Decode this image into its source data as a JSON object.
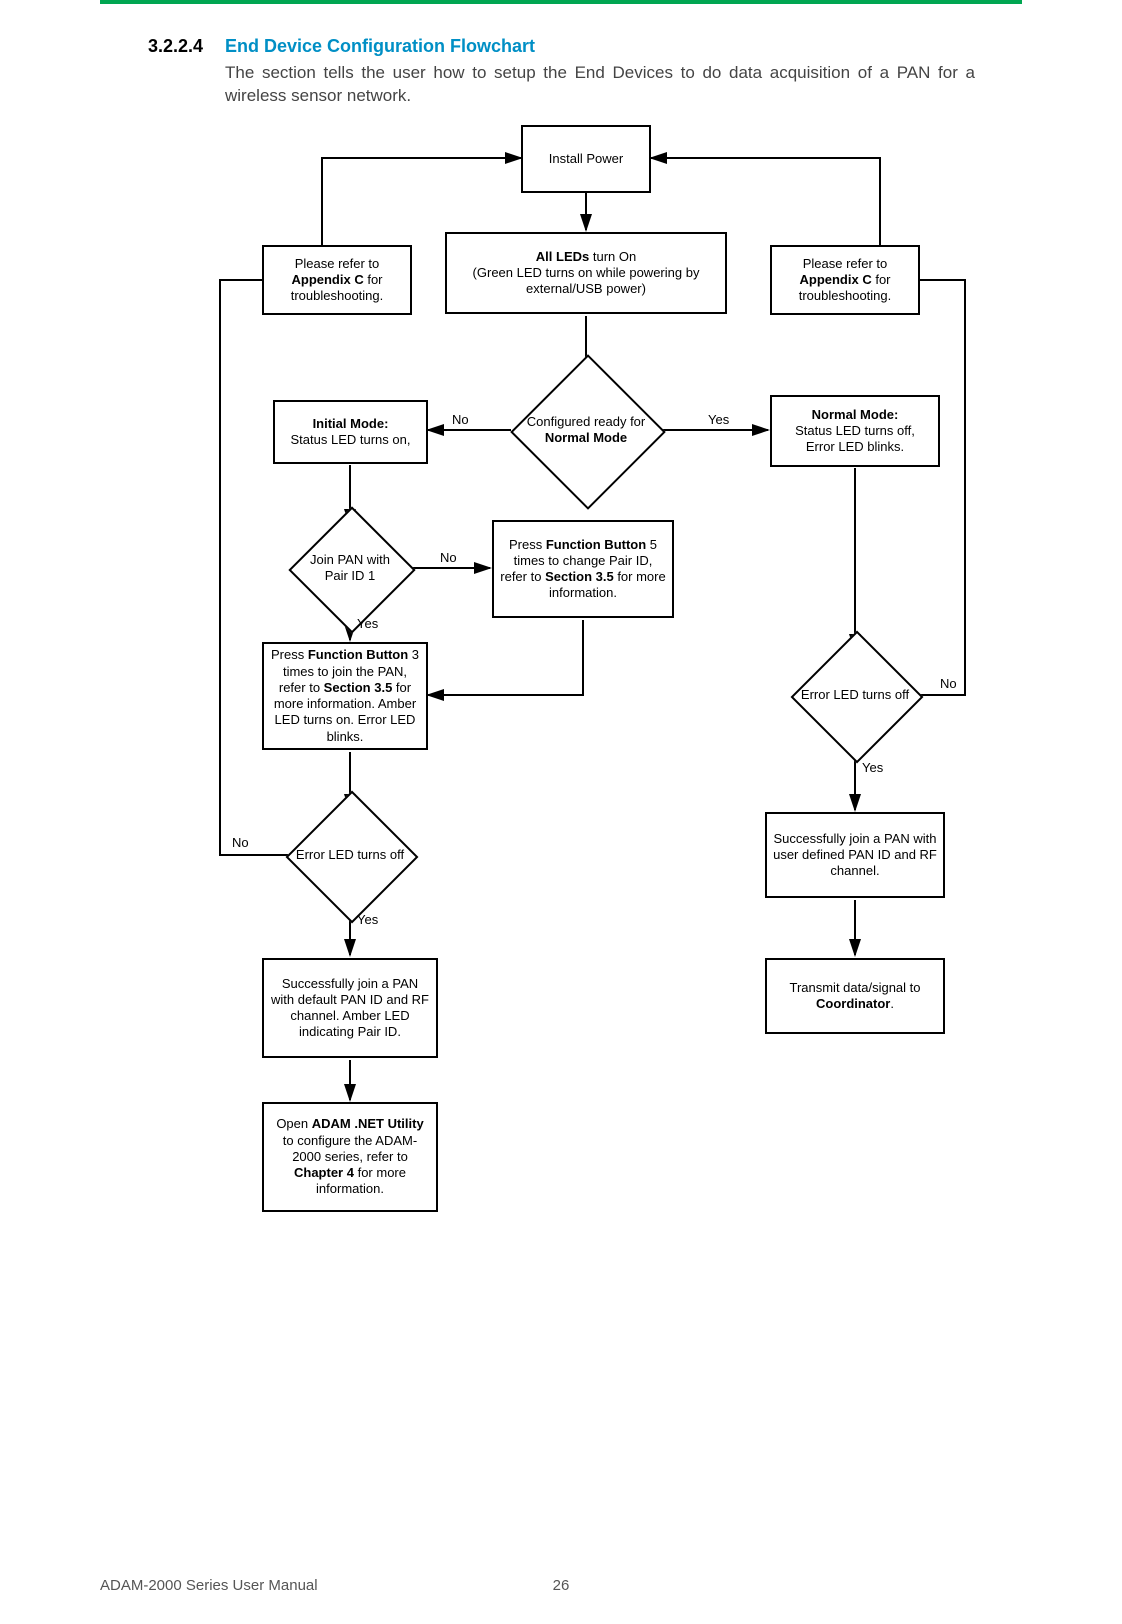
{
  "header": {
    "section_number": "3.2.2.4",
    "section_title": "End Device Configuration Flowchart",
    "intro": "The section tells the user how to setup the End Devices to do data acquisition of a PAN for a wireless sensor network."
  },
  "footer": {
    "manual": "ADAM-2000 Series User Manual",
    "page": "26"
  },
  "labels": {
    "yes": "Yes",
    "no": "No"
  },
  "nodes": {
    "install_power": "Install Power",
    "all_leds": "<b>All LEDs</b> turn On<br>(Green LED turns on while powering by external/USB power)",
    "trouble_left": "Please refer to <b>Appendix C</b> for troubleshooting.",
    "trouble_right": "Please refer to <b>Appendix C</b> for troubleshooting.",
    "configured": "Configured ready for<br><b>Normal Mode</b>",
    "initial_mode": "<b>Initial Mode:</b><br>Status LED turns on,",
    "normal_mode": "<b>Normal Mode:</b><br>Status LED turns off,<br>Error LED blinks.",
    "join_pan": "Join PAN with<br>Pair ID 1",
    "press5": "Press <b>Function Button</b> 5 times to change Pair ID, refer to <b>Section 3.5</b> for more information.",
    "press3": "Press <b>Function Button</b> 3 times to join the PAN, refer to <b>Section 3.5</b> for more information. Amber LED turns on. Error LED blinks.",
    "error_off_left": "Error LED turns off",
    "error_off_right": "Error LED turns off",
    "join_default": "Successfully join a PAN with default PAN ID and RF channel. Amber LED indicating Pair ID.",
    "join_user": "Successfully join a PAN with user defined PAN ID and RF channel.",
    "open_util": "Open <b>ADAM .NET Utility</b> to configure the ADAM-2000 series, refer to <b>Chapter 4</b> for more information.",
    "transmit": "Transmit data/signal to <b>Coordinator</b>."
  },
  "chart_data": {
    "type": "flowchart",
    "nodes": [
      {
        "id": "install_power",
        "kind": "process",
        "text": "Install Power"
      },
      {
        "id": "all_leds",
        "kind": "process",
        "text": "All LEDs turn On (Green LED turns on while powering by external/USB power)"
      },
      {
        "id": "trouble_left",
        "kind": "process",
        "text": "Please refer to Appendix C for troubleshooting."
      },
      {
        "id": "trouble_right",
        "kind": "process",
        "text": "Please refer to Appendix C for troubleshooting."
      },
      {
        "id": "configured",
        "kind": "decision",
        "text": "Configured ready for Normal Mode"
      },
      {
        "id": "initial_mode",
        "kind": "process",
        "text": "Initial Mode: Status LED turns on,"
      },
      {
        "id": "normal_mode",
        "kind": "process",
        "text": "Normal Mode: Status LED turns off, Error LED blinks."
      },
      {
        "id": "join_pan",
        "kind": "decision",
        "text": "Join PAN with Pair ID 1"
      },
      {
        "id": "press5",
        "kind": "process",
        "text": "Press Function Button 5 times to change Pair ID, refer to Section 3.5 for more information."
      },
      {
        "id": "press3",
        "kind": "process",
        "text": "Press Function Button 3 times to join the PAN, refer to Section 3.5 for more information. Amber LED turns on. Error LED blinks."
      },
      {
        "id": "error_off_left",
        "kind": "decision",
        "text": "Error LED turns off"
      },
      {
        "id": "error_off_right",
        "kind": "decision",
        "text": "Error LED turns off"
      },
      {
        "id": "join_default",
        "kind": "process",
        "text": "Successfully join a PAN with default PAN ID and RF channel. Amber LED indicating Pair ID."
      },
      {
        "id": "join_user",
        "kind": "process",
        "text": "Successfully join a PAN with user defined PAN ID and RF channel."
      },
      {
        "id": "open_util",
        "kind": "process",
        "text": "Open ADAM .NET Utility to configure the ADAM-2000 series, refer to Chapter 4 for more information."
      },
      {
        "id": "transmit",
        "kind": "process",
        "text": "Transmit data/signal to Coordinator."
      }
    ],
    "edges": [
      {
        "from": "install_power",
        "to": "all_leds"
      },
      {
        "from": "all_leds",
        "to": "configured"
      },
      {
        "from": "configured",
        "to": "initial_mode",
        "label": "No"
      },
      {
        "from": "configured",
        "to": "normal_mode",
        "label": "Yes"
      },
      {
        "from": "initial_mode",
        "to": "join_pan"
      },
      {
        "from": "join_pan",
        "to": "press5",
        "label": "No"
      },
      {
        "from": "join_pan",
        "to": "press3",
        "label": "Yes"
      },
      {
        "from": "press5",
        "to": "press3"
      },
      {
        "from": "press3",
        "to": "error_off_left"
      },
      {
        "from": "error_off_left",
        "to": "trouble_left",
        "label": "No"
      },
      {
        "from": "trouble_left",
        "to": "install_power"
      },
      {
        "from": "error_off_left",
        "to": "join_default",
        "label": "Yes"
      },
      {
        "from": "join_default",
        "to": "open_util"
      },
      {
        "from": "normal_mode",
        "to": "error_off_right"
      },
      {
        "from": "error_off_right",
        "to": "trouble_right",
        "label": "No"
      },
      {
        "from": "trouble_right",
        "to": "install_power"
      },
      {
        "from": "error_off_right",
        "to": "join_user",
        "label": "Yes"
      },
      {
        "from": "join_user",
        "to": "transmit"
      }
    ]
  }
}
